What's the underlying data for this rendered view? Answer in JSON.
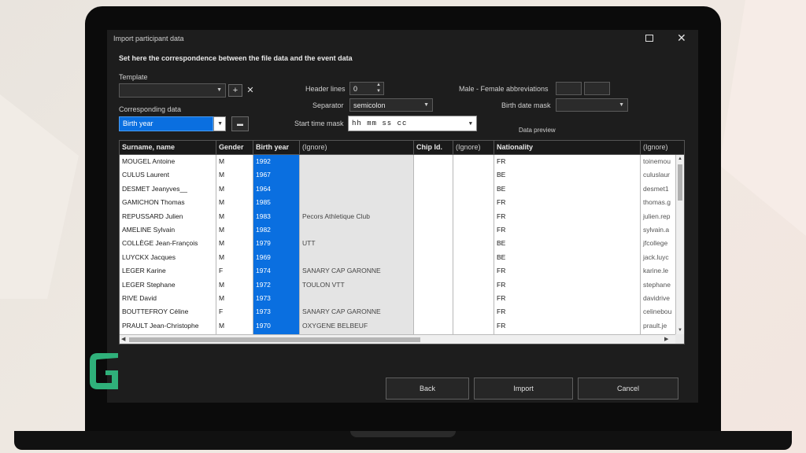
{
  "window": {
    "title": "Import participant data"
  },
  "heading": "Set here the correspondence between the file data and the event data",
  "template": {
    "label": "Template",
    "value": "",
    "add_symbol": "+",
    "remove_symbol": "✕"
  },
  "corresponding": {
    "label": "Corresponding data",
    "value": "Birth year"
  },
  "header_lines": {
    "label": "Header lines",
    "value": "0"
  },
  "separator": {
    "label": "Separator",
    "value": "semicolon"
  },
  "start_time_mask": {
    "label": "Start time mask",
    "value": "hh mm ss cc"
  },
  "abbrev": {
    "label": "Male - Female abbreviations",
    "male": "",
    "female": ""
  },
  "birth_mask": {
    "label": "Birth date mask",
    "value": ""
  },
  "preview_label": "Data preview",
  "columns": [
    "Surname, name",
    "Gender",
    "Birth year",
    "(Ignore)",
    "Chip Id.",
    "(Ignore)",
    "Nationality",
    "(Ignore)"
  ],
  "rows": [
    [
      "MOUGEL Antoine",
      "M",
      "1992",
      "",
      "",
      "",
      "FR",
      "toinemou"
    ],
    [
      "CULUS Laurent",
      "M",
      "1967",
      "",
      "",
      "",
      "BE",
      "culuslaur"
    ],
    [
      "DESMET Jeanyves__",
      "M",
      "1964",
      "",
      "",
      "",
      "BE",
      "desmet1"
    ],
    [
      "GAMICHON Thomas",
      "M",
      "1985",
      "",
      "",
      "",
      "FR",
      "thomas.g"
    ],
    [
      "REPUSSARD Julien",
      "M",
      "1983",
      "Pecors Athletique Club",
      "",
      "",
      "FR",
      "julien.rep"
    ],
    [
      "AMELINE Sylvain",
      "M",
      "1982",
      "",
      "",
      "",
      "FR",
      "sylvain.a"
    ],
    [
      "COLLÈGE Jean-François",
      "M",
      "1979",
      "UTT",
      "",
      "",
      "BE",
      "jfcollege"
    ],
    [
      "LUYCKX Jacques",
      "M",
      "1969",
      "",
      "",
      "",
      "BE",
      "jack.luyc"
    ],
    [
      "LEGER Karine",
      "F",
      "1974",
      "SANARY CAP GARONNE",
      "",
      "",
      "FR",
      "karine.le"
    ],
    [
      "LEGER Stephane",
      "M",
      "1972",
      "TOULON VTT",
      "",
      "",
      "FR",
      "stephane"
    ],
    [
      "RIVE David",
      "M",
      "1973",
      "",
      "",
      "",
      "FR",
      "davidrive"
    ],
    [
      "BOUTTEFROY Céline",
      "F",
      "1973",
      "SANARY CAP GARONNE",
      "",
      "",
      "FR",
      "celinebou"
    ],
    [
      "PRAULT Jean-Christophe",
      "M",
      "1970",
      "OXYGENE BELBEUF",
      "",
      "",
      "FR",
      "prault.je"
    ]
  ],
  "buttons": {
    "back": "Back",
    "import": "Import",
    "cancel": "Cancel"
  },
  "colors": {
    "selection_blue": "#0a6fe0",
    "dialog_bg": "#1d1d1d",
    "logo_green": "#2fb07a"
  },
  "icons": {
    "maximize": "maximize-icon",
    "close": "close-icon",
    "export": "export-icon"
  }
}
